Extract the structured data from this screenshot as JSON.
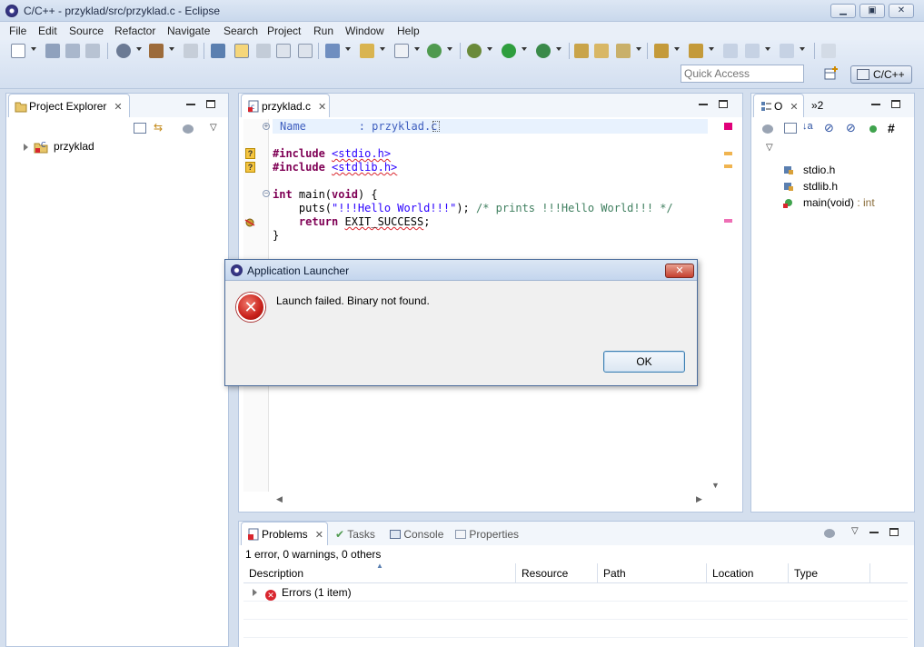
{
  "window": {
    "title": "C/C++ - przyklad/src/przyklad.c - Eclipse"
  },
  "menu": [
    "File",
    "Edit",
    "Source",
    "Refactor",
    "Navigate",
    "Search",
    "Project",
    "Run",
    "Window",
    "Help"
  ],
  "quick_access": {
    "placeholder": "Quick Access"
  },
  "perspective": {
    "label": "C/C++"
  },
  "project_explorer": {
    "tab": "Project Explorer",
    "items": [
      {
        "label": "przyklad"
      }
    ]
  },
  "editor": {
    "tab": "przyklad.c",
    "header_line": "Name        : przyklad.c",
    "lines": {
      "inc1_kw": "#include",
      "inc1_val": "<stdio.h>",
      "inc2_kw": "#include",
      "inc2_val": "<stdlib.h>",
      "main_int": "int",
      "main_rest": " main(",
      "main_void": "void",
      "main_end": ") {",
      "puts_pre": "    puts(",
      "puts_str": "\"!!!Hello World!!!\"",
      "puts_end": "); ",
      "puts_cmt": "/* prints !!!Hello World!!! */",
      "ret_kw": "return",
      "ret_val": "EXIT_SUCCESS",
      "ret_end": ";",
      "close": "}"
    }
  },
  "outline": {
    "tab": "O",
    "overflow": "»2",
    "items": [
      {
        "label": "stdio.h"
      },
      {
        "label": "stdlib.h"
      },
      {
        "label": "main(void)",
        "type": " : int"
      }
    ]
  },
  "bottom": {
    "tabs": [
      "Problems",
      "Tasks",
      "Console",
      "Properties"
    ],
    "summary": "1 error, 0 warnings, 0 others",
    "columns": [
      "Description",
      "Resource",
      "Path",
      "Location",
      "Type"
    ],
    "rows": [
      {
        "description": "Errors (1 item)"
      }
    ]
  },
  "dialog": {
    "title": "Application Launcher",
    "message": "Launch failed. Binary not found.",
    "ok": "OK",
    "close": "✕"
  },
  "colors": {
    "error": "#d9262e",
    "keyword": "#7f0055",
    "string": "#2a00ff",
    "comment": "#3f7f5f"
  }
}
